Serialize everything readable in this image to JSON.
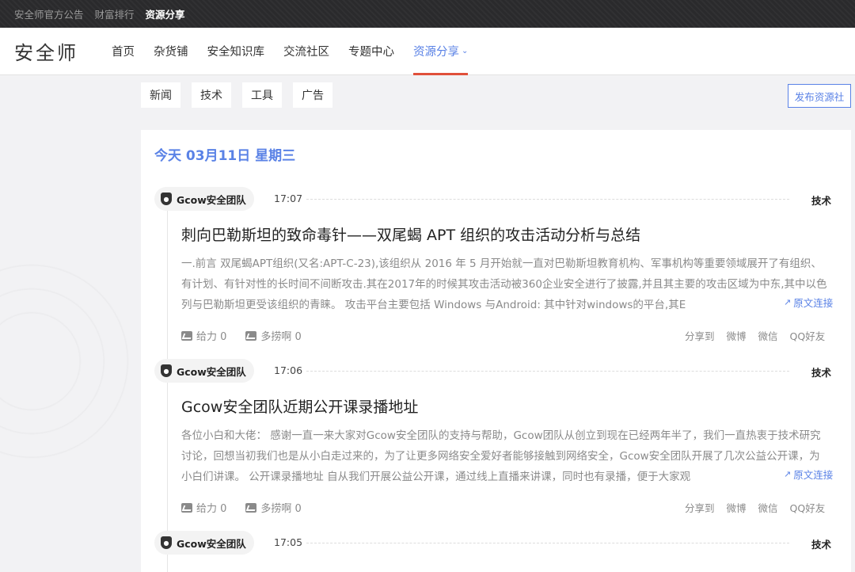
{
  "topbar": {
    "links": [
      "安全师官方公告",
      "财富排行",
      "资源分享"
    ]
  },
  "header": {
    "logo": "安全师",
    "nav": [
      "首页",
      "杂货铺",
      "安全知识库",
      "交流社区",
      "专题中心",
      "资源分享"
    ],
    "chevron_icon": "chevron-down-icon"
  },
  "categories": [
    "新闻",
    "技术",
    "工具",
    "广告"
  ],
  "publish_label": "发布资源社",
  "date_heading": "今天 03月11日 星期三",
  "entries": [
    {
      "author": "Gcow安全团队",
      "time": "17:07",
      "category": "技术",
      "title": "刺向巴勒斯坦的致命毒针——双尾蝎 APT 组织的攻击活动分析与总结",
      "summary": "一.前言 双尾蝎APT组织(又名:APT-C-23),该组织从 2016 年 5 月开始就一直对巴勒斯坦教育机构、军事机构等重要领域展开了有组织、有计划、有针对性的长时间不间断攻击.其在2017年的时候其攻击活动被360企业安全进行了披露,并且其主要的攻击区域为中东,其中以色列与巴勒斯坦更受该组织的青睐。 攻击平台主要包括 Windows 与Android: 其中针对windows的平台,其E",
      "link": "原文连接",
      "like": "给力 0",
      "dislike": "多捞啊 0",
      "share_label": "分享到",
      "share": [
        "微博",
        "微信",
        "QQ好友"
      ]
    },
    {
      "author": "Gcow安全团队",
      "time": "17:06",
      "category": "技术",
      "title": "Gcow安全团队近期公开课录播地址",
      "summary": "各位小白和大佬： 感谢一直一来大家对Gcow安全团队的支持与帮助，Gcow团队从创立到现在已经两年半了，我们一直热衷于技术研究讨论，回想当初我们也是从小白走过来的，为了让更多网络安全爱好者能够接触到网络安全，Gcow安全团队开展了几次公益公开课，为小白们讲课。 公开课录播地址 自从我们开展公益公开课，通过线上直播来讲课，同时也有录播，便于大家观",
      "link": "原文连接",
      "like": "给力 0",
      "dislike": "多捞啊 0",
      "share_label": "分享到",
      "share": [
        "微博",
        "微信",
        "QQ好友"
      ]
    },
    {
      "author": "Gcow安全团队",
      "time": "17:05",
      "category": "技术"
    }
  ]
}
